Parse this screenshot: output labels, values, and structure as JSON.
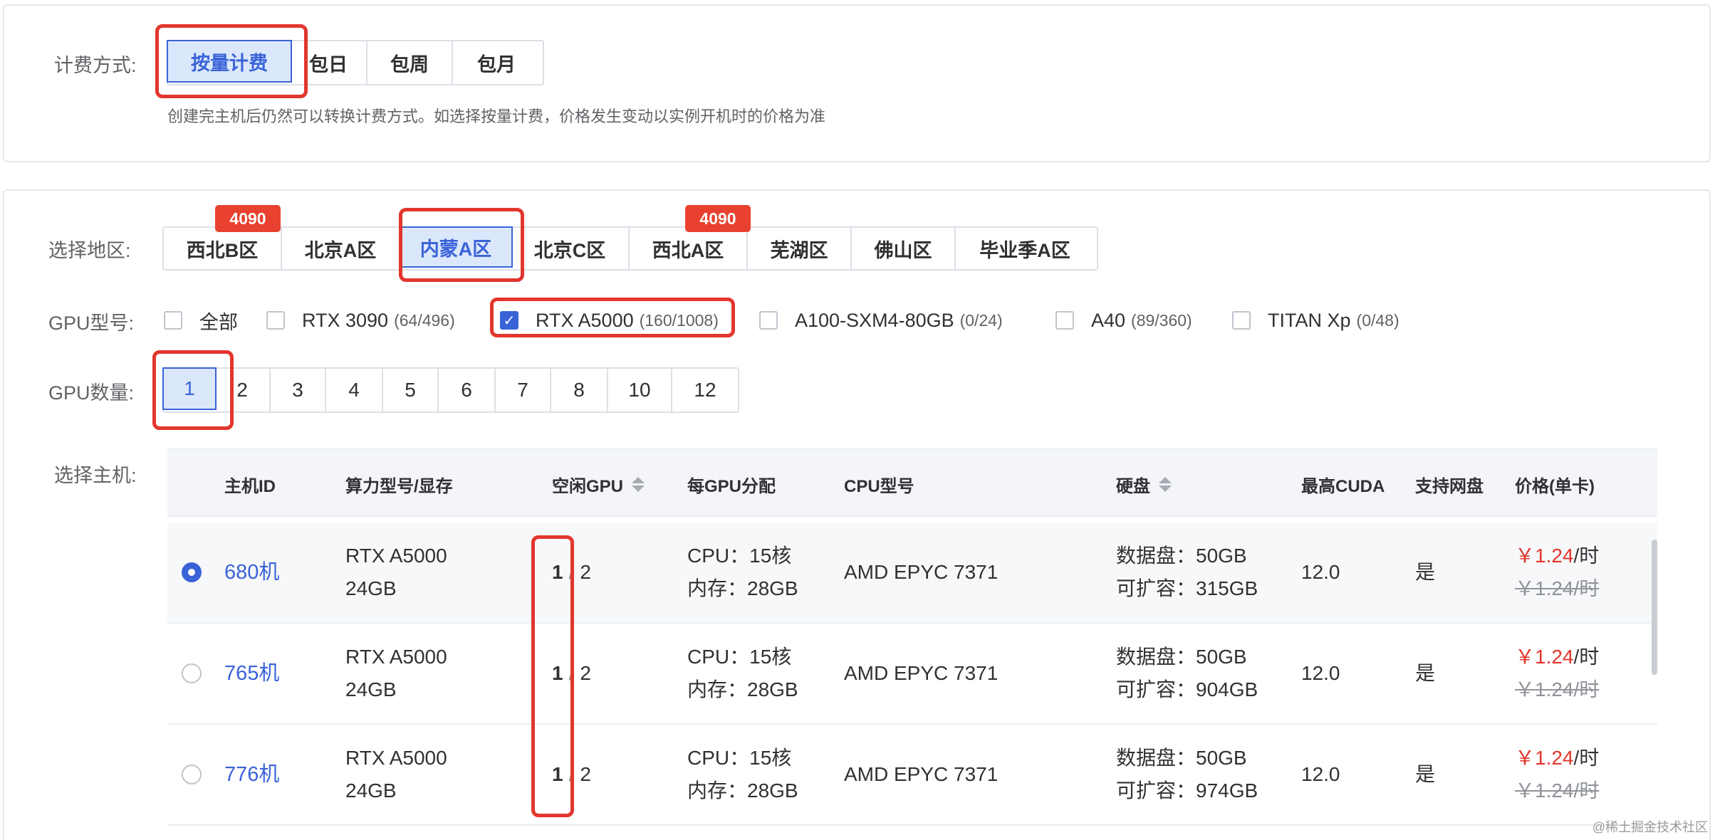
{
  "billing": {
    "label": "计费方式:",
    "options": [
      "按量计费",
      "包日",
      "包周",
      "包月"
    ],
    "active_index": 0,
    "hint": "创建完主机后仍然可以转换计费方式。如选择按量计费，价格发生变动以实例开机时的价格为准"
  },
  "region": {
    "label": "选择地区:",
    "options": [
      "西北B区",
      "北京A区",
      "内蒙A区",
      "北京C区",
      "西北A区",
      "芜湖区",
      "佛山区",
      "毕业季A区"
    ],
    "active_index": 2,
    "badges": [
      {
        "region": "西北B区",
        "text": "4090"
      },
      {
        "region": "西北A区",
        "text": "4090"
      }
    ]
  },
  "gpu_model": {
    "label": "GPU型号:",
    "options": [
      {
        "name": "全部",
        "count": "",
        "checked": false
      },
      {
        "name": "RTX 3090",
        "count": "(64/496)",
        "checked": false
      },
      {
        "name": "RTX A5000",
        "count": "(160/1008)",
        "checked": true
      },
      {
        "name": "A100-SXM4-80GB",
        "count": "(0/24)",
        "checked": false
      },
      {
        "name": "A40",
        "count": "(89/360)",
        "checked": false
      },
      {
        "name": "TITAN Xp",
        "count": "(0/48)",
        "checked": false
      }
    ]
  },
  "gpu_count": {
    "label": "GPU数量:",
    "options": [
      "1",
      "2",
      "3",
      "4",
      "5",
      "6",
      "7",
      "8",
      "10",
      "12"
    ],
    "active_index": 0
  },
  "hosts": {
    "label": "选择主机:",
    "columns": [
      "主机ID",
      "算力型号/显存",
      "空闲GPU",
      "每GPU分配",
      "CPU型号",
      "硬盘",
      "最高CUDA",
      "支持网盘",
      "价格(单卡)"
    ],
    "rows": [
      {
        "id": "680机",
        "selected": true,
        "model": "RTX A5000",
        "vram": "24GB",
        "free": "1",
        "total": "2",
        "cpu": "CPU：15核",
        "mem": "内存：28GB",
        "cpu_model": "AMD EPYC 7371",
        "disk": "数据盘：50GB",
        "disk_ext": "可扩容：315GB",
        "cuda": "12.0",
        "netdisk": "是",
        "price": "￥1.24",
        "unit": "/时",
        "old_price": "￥1.24/时"
      },
      {
        "id": "765机",
        "selected": false,
        "model": "RTX A5000",
        "vram": "24GB",
        "free": "1",
        "total": "2",
        "cpu": "CPU：15核",
        "mem": "内存：28GB",
        "cpu_model": "AMD EPYC 7371",
        "disk": "数据盘：50GB",
        "disk_ext": "可扩容：904GB",
        "cuda": "12.0",
        "netdisk": "是",
        "price": "￥1.24",
        "unit": "/时",
        "old_price": "￥1.24/时"
      },
      {
        "id": "776机",
        "selected": false,
        "model": "RTX A5000",
        "vram": "24GB",
        "free": "1",
        "total": "2",
        "cpu": "CPU：15核",
        "mem": "内存：28GB",
        "cpu_model": "AMD EPYC 7371",
        "disk": "数据盘：50GB",
        "disk_ext": "可扩容：974GB",
        "cuda": "12.0",
        "netdisk": "是",
        "price": "￥1.24",
        "unit": "/时",
        "old_price": "￥1.24/时"
      }
    ]
  },
  "watermark": "@稀土掘金技术社区",
  "colors": {
    "accent": "#3a63d8",
    "highlight_box": "#e2362d",
    "badge": "#e8412f",
    "price": "#e2362d"
  }
}
